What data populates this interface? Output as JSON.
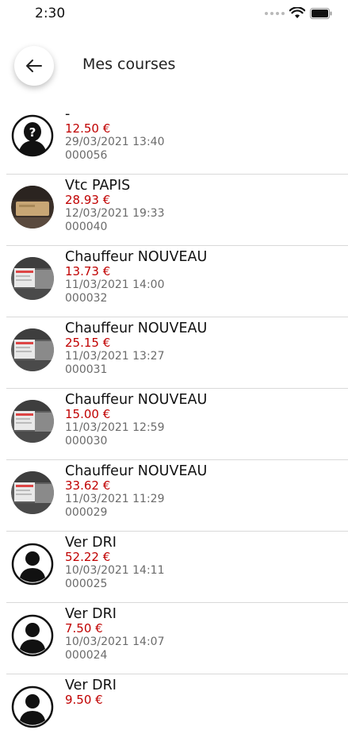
{
  "status": {
    "time": "2:30"
  },
  "header": {
    "title": "Mes courses"
  },
  "colors": {
    "amount": "#c00000",
    "divider": "#d9d9d9"
  },
  "rides": [
    {
      "name": "-",
      "amount": "12.50 €",
      "datetime": "29/03/2021 13:40",
      "code": "000056",
      "avatar": "unknown-user-icon"
    },
    {
      "name": "Vtc PAPIS",
      "amount": "28.93 €",
      "datetime": "12/03/2021 19:33",
      "code": "000040",
      "avatar": "driver-photo"
    },
    {
      "name": "Chauffeur NOUVEAU",
      "amount": "13.73 €",
      "datetime": "11/03/2021 14:00",
      "code": "000032",
      "avatar": "screen-photo"
    },
    {
      "name": "Chauffeur NOUVEAU",
      "amount": "25.15 €",
      "datetime": "11/03/2021 13:27",
      "code": "000031",
      "avatar": "screen-photo"
    },
    {
      "name": "Chauffeur NOUVEAU",
      "amount": "15.00 €",
      "datetime": "11/03/2021 12:59",
      "code": "000030",
      "avatar": "screen-photo"
    },
    {
      "name": "Chauffeur NOUVEAU",
      "amount": "33.62 €",
      "datetime": "11/03/2021 11:29",
      "code": "000029",
      "avatar": "screen-photo"
    },
    {
      "name": "Ver DRI",
      "amount": "52.22 €",
      "datetime": "10/03/2021 14:11",
      "code": "000025",
      "avatar": "user-icon"
    },
    {
      "name": "Ver DRI",
      "amount": "7.50 €",
      "datetime": "10/03/2021 14:07",
      "code": "000024",
      "avatar": "user-icon"
    },
    {
      "name": "Ver DRI",
      "amount": "9.50 €",
      "datetime": "",
      "code": "",
      "avatar": "user-icon"
    }
  ]
}
